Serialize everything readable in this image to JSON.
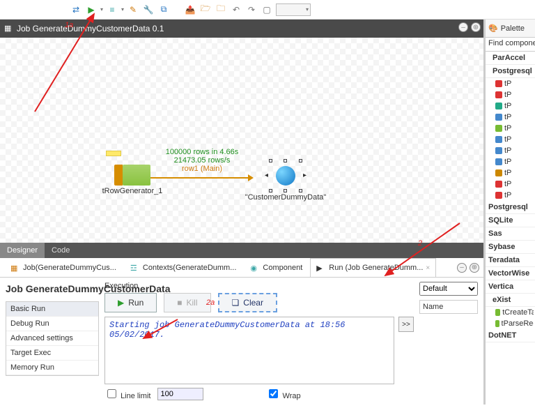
{
  "annotations": {
    "a1": "1a",
    "a2": "2a",
    "a3": "2"
  },
  "toolbar": {
    "icons": [
      "arrows",
      "play",
      "play-dd",
      "db",
      "db-dd",
      "edit",
      "wrench",
      "chain",
      "open1",
      "open2",
      "open3",
      "undo",
      "redo",
      "doc"
    ],
    "combo_value": ""
  },
  "editor": {
    "tab_title": "Job GenerateDummyCustomerData 0.1",
    "bottom_tabs": {
      "designer": "Designer",
      "code": "Code"
    }
  },
  "canvas": {
    "comp_left_label": "tRowGenerator_1",
    "comp_right_label": "\"CustomerDummyData\"",
    "link_line1": "100000 rows in 4.66s",
    "link_line2": "21473.05 rows/s",
    "link_line3": "row1 (Main)"
  },
  "views": {
    "job": "Job(GenerateDummyCus...",
    "contexts": "Contexts(GenerateDumm...",
    "component": "Component",
    "run": "Run (Job GenerateDumm..."
  },
  "run": {
    "heading": "Job GenerateDummyCustomerData",
    "nav": {
      "basic": "Basic Run",
      "debug": "Debug Run",
      "advanced": "Advanced settings",
      "target": "Target Exec",
      "memory": "Memory Run"
    },
    "exec_label": "Execution",
    "run_btn": "Run",
    "kill_btn": "Kill",
    "clear_btn": "Clear",
    "console_text": "Starting job GenerateDummyCustomerData at 18:56 05/02/2017.",
    "line_limit_label": "Line limit",
    "line_limit_value": "100",
    "wrap_label": "Wrap",
    "expand_btn": ">>",
    "context_select": "Default",
    "name_header": "Name"
  },
  "palette": {
    "title": "Palette",
    "search_placeholder": "Find component",
    "cat_paraccel": "ParAccel",
    "cat_postgresql_top": "Postgresql",
    "items_top": [
      "tPostgresqlBulkExec",
      "tPostgresqlClose",
      "tPostgresqlCommit",
      "tPostgresqlConnection",
      "tPostgresqlInput",
      "tPostgresqlOutput",
      "tPostgresqlOutputBulk",
      "tPostgresqlOutputBulkExec",
      "tPostgresqlRollback",
      "tPostgresqlRow",
      "tPostgresqlSCD"
    ],
    "cats_bottom": [
      "Postgresql",
      "SQLite",
      "Sas",
      "Sybase",
      "Teradata",
      "VectorWise",
      "Vertica"
    ],
    "cat_exist": "eXist",
    "exist_items": [
      "tCreateTable",
      "tParseRecordSet"
    ],
    "cat_dotnet": "DotNET"
  }
}
